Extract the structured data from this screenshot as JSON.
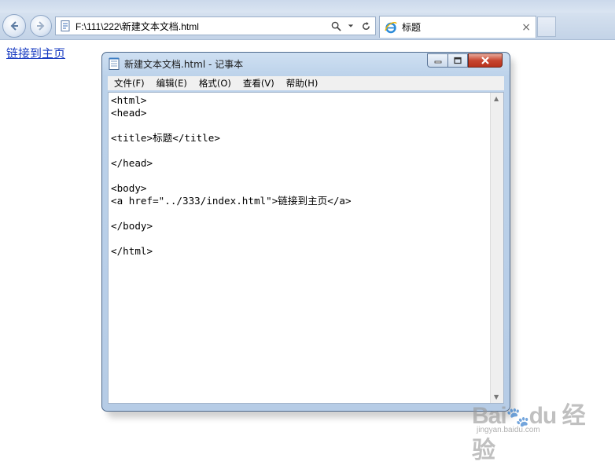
{
  "browser": {
    "address": "F:\\111\\222\\新建文本文档.html",
    "tab_title": "标题",
    "tab_close": "×"
  },
  "page": {
    "link_text": "链接到主页"
  },
  "notepad": {
    "title": "新建文本文档.html - 记事本",
    "menu": [
      "文件(F)",
      "编辑(E)",
      "格式(O)",
      "查看(V)",
      "帮助(H)"
    ],
    "content": "<html>\n<head>\n\n<title>标题</title>\n\n</head>\n\n<body>\n<a href=\"../333/index.html\">链接到主页</a>\n\n</body>\n\n</html>"
  },
  "watermark": {
    "logo": "Bai du 经验",
    "sub": "jingyan.baidu.com"
  }
}
